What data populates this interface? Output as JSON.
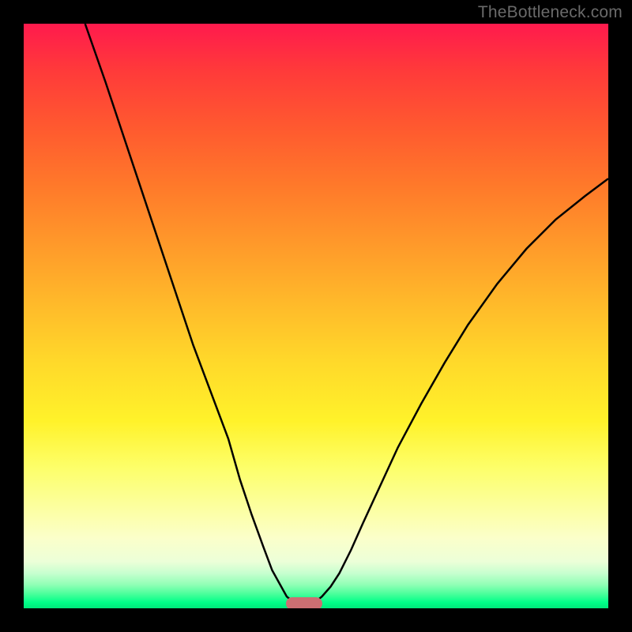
{
  "watermark": "TheBottleneck.com",
  "chart_data": {
    "type": "line",
    "title": "",
    "xlabel": "",
    "ylabel": "",
    "xlim": [
      0,
      100
    ],
    "ylim": [
      0,
      100
    ],
    "series": [
      {
        "name": "left-branch",
        "x": [
          10.5,
          14,
          17,
          20,
          23,
          26,
          29,
          32,
          35,
          37,
          39,
          41,
          42.5,
          44,
          45,
          46
        ],
        "y": [
          100,
          90,
          81,
          72,
          63,
          54,
          45,
          37,
          29,
          22,
          16,
          10.5,
          6.5,
          3.8,
          2.0,
          1.2
        ]
      },
      {
        "name": "right-branch",
        "x": [
          50,
          51,
          52.5,
          54,
          56,
          58,
          61,
          64,
          68,
          72,
          76,
          81,
          86,
          91,
          96,
          100
        ],
        "y": [
          1.2,
          2.0,
          3.7,
          6.0,
          10.0,
          14.5,
          21.0,
          27.5,
          35.0,
          42.0,
          48.5,
          55.5,
          61.5,
          66.5,
          70.5,
          73.5
        ]
      }
    ],
    "marker": {
      "x_center": 48,
      "y": 0.8,
      "width_pct": 6.2,
      "color": "#cc6f72"
    }
  },
  "colors": {
    "curve": "#000000",
    "background_top": "#ff1a4d",
    "background_bottom": "#00e87a",
    "frame": "#000000"
  }
}
